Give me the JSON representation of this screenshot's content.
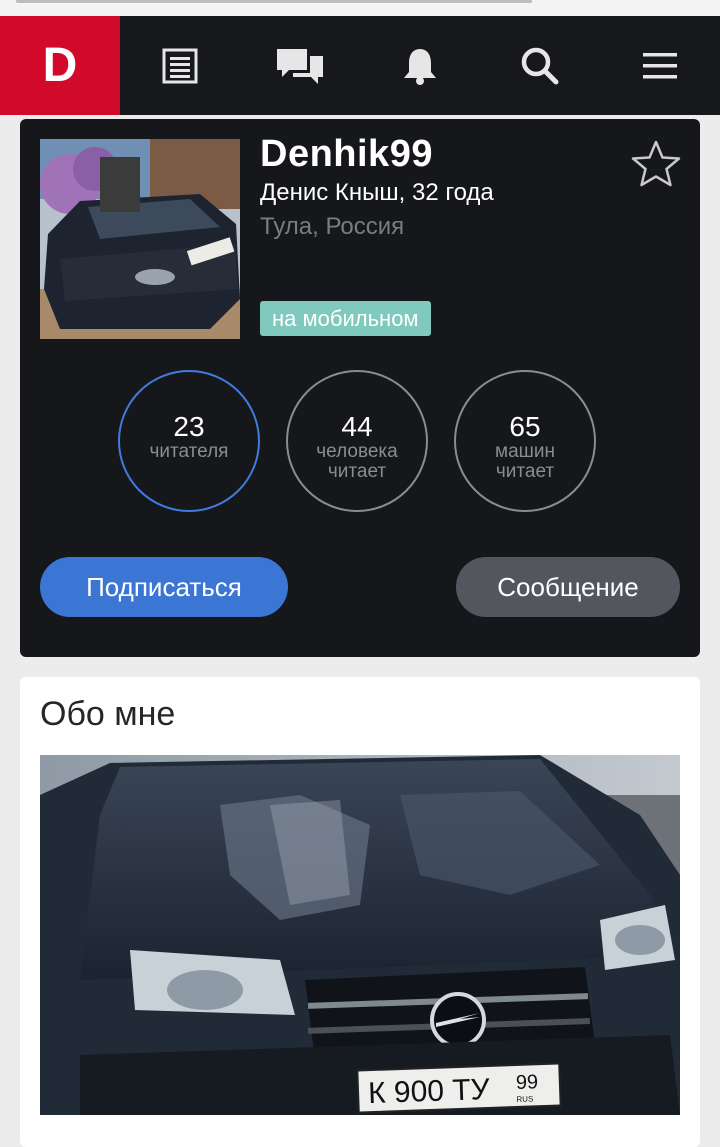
{
  "navbar": {
    "logo_text": "D",
    "icons": [
      "feed-icon",
      "messages-icon",
      "notifications-icon",
      "search-icon",
      "menu-icon"
    ]
  },
  "profile": {
    "username": "Denhik99",
    "realname_age": "Денис Кныш, 32 года",
    "location": "Тула, Россия",
    "badge": "на мобильном",
    "stats": [
      {
        "value": "23",
        "label": "читателя"
      },
      {
        "value": "44",
        "label": "человека читает"
      },
      {
        "value": "65",
        "label": "машин читает"
      }
    ],
    "subscribe_label": "Подписаться",
    "message_label": "Сообщение"
  },
  "about": {
    "title": "Обо мне",
    "plate": {
      "number": "К 900 ТУ",
      "region": "99",
      "country": "RUS"
    }
  },
  "colors": {
    "brand_red": "#d10a2c",
    "navbar_bg": "#17181c",
    "card_bg": "#15171b",
    "accent_blue": "#3c76d5",
    "badge_teal": "#7fc9bf",
    "message_gray": "#53575d"
  }
}
